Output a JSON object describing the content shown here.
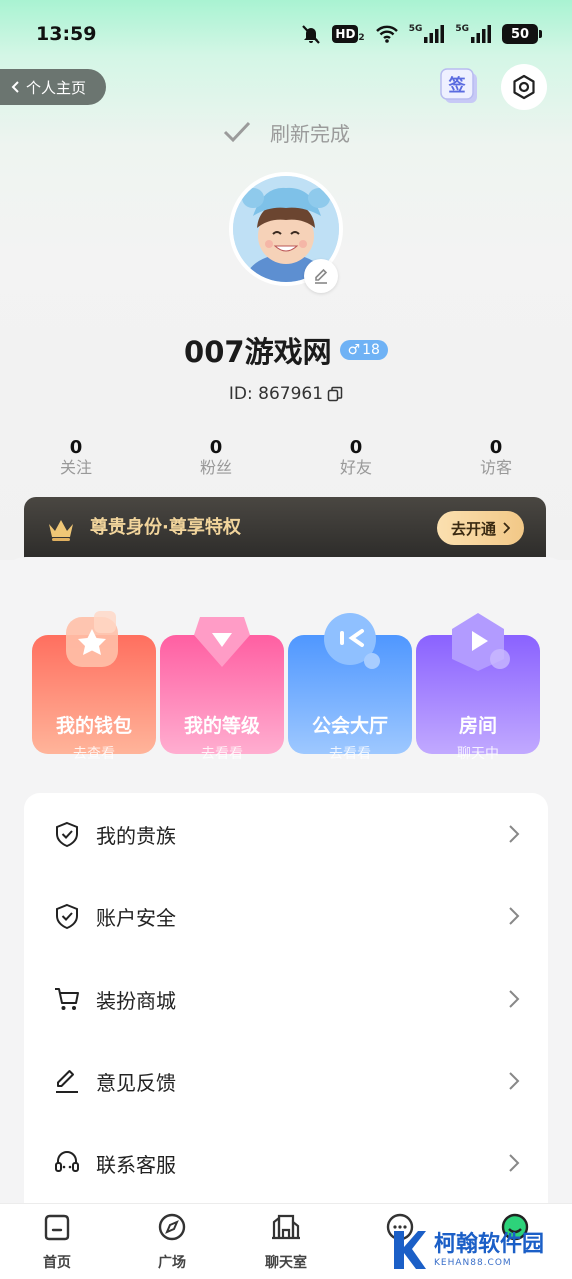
{
  "status_bar": {
    "time": "13:59",
    "hd_label": "HD",
    "hd_sub": "2",
    "net1": "5G",
    "net2": "5G",
    "battery": "50"
  },
  "header": {
    "back_label": "个人主页",
    "sign_label": "签",
    "refresh_text": "刷新完成"
  },
  "profile": {
    "username": "007游戏网",
    "gender_symbol": "♂",
    "age": "18",
    "id_text": "ID: 867961"
  },
  "stats": [
    {
      "value": "0",
      "label": "关注"
    },
    {
      "value": "0",
      "label": "粉丝"
    },
    {
      "value": "0",
      "label": "好友"
    },
    {
      "value": "0",
      "label": "访客"
    }
  ],
  "vip": {
    "text": "尊贵身份·尊享特权",
    "button": "去开通"
  },
  "tiles": [
    {
      "title": "我的钱包",
      "sub": "去查看",
      "color_from": "#ff6f5f",
      "color_to": "#ffb49a"
    },
    {
      "title": "我的等级",
      "sub": "去看看",
      "color_from": "#ff5fa2",
      "color_to": "#ffaed0"
    },
    {
      "title": "公会大厅",
      "sub": "去看看",
      "color_from": "#4f97ff",
      "color_to": "#9ec8ff"
    },
    {
      "title": "房间",
      "sub": "聊天中",
      "color_from": "#8a62ff",
      "color_to": "#c1a9ff"
    }
  ],
  "menu": [
    {
      "label": "我的贵族",
      "icon": "shield-check-icon"
    },
    {
      "label": "账户安全",
      "icon": "shield-check-icon"
    },
    {
      "label": "装扮商城",
      "icon": "cart-icon"
    },
    {
      "label": "意见反馈",
      "icon": "pencil-icon"
    },
    {
      "label": "联系客服",
      "icon": "headset-icon"
    }
  ],
  "tabs": [
    {
      "label": "首页",
      "icon": "home-icon"
    },
    {
      "label": "广场",
      "icon": "compass-icon"
    },
    {
      "label": "聊天室",
      "icon": "building-icon"
    },
    {
      "label": "",
      "icon": "message-icon"
    },
    {
      "label": "",
      "icon": "profile-icon"
    }
  ],
  "watermark": {
    "title": "柯翰软件园",
    "sub": "KEHAN88.COM"
  }
}
